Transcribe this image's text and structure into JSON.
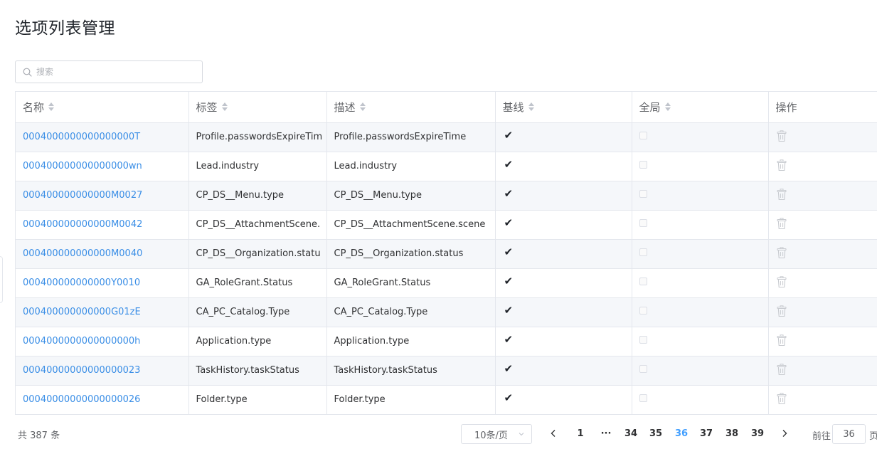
{
  "page": {
    "title": "选项列表管理"
  },
  "search": {
    "placeholder": "搜索",
    "value": ""
  },
  "table": {
    "columns": [
      "名称",
      "标签",
      "描述",
      "基线",
      "全局",
      "操作"
    ],
    "rows": [
      {
        "name": "0004000000000000000T",
        "label": "Profile.passwordsExpireTim",
        "desc": "Profile.passwordsExpireTime",
        "baseline": "✔"
      },
      {
        "name": "000400000000000000wn",
        "label": "Lead.industry",
        "desc": "Lead.industry",
        "baseline": "✔"
      },
      {
        "name": "000400000000000M0027",
        "label": "CP_DS__Menu.type",
        "desc": "CP_DS__Menu.type",
        "baseline": "✔"
      },
      {
        "name": "000400000000000M0042",
        "label": "CP_DS__AttachmentScene.",
        "desc": "CP_DS__AttachmentScene.scene",
        "baseline": "✔"
      },
      {
        "name": "000400000000000M0040",
        "label": "CP_DS__Organization.statu",
        "desc": "CP_DS__Organization.status",
        "baseline": "✔"
      },
      {
        "name": "000400000000000Y0010",
        "label": "GA_RoleGrant.Status",
        "desc": "GA_RoleGrant.Status",
        "baseline": "✔"
      },
      {
        "name": "000400000000000G01zE",
        "label": "CA_PC_Catalog.Type",
        "desc": "CA_PC_Catalog.Type",
        "baseline": "✔"
      },
      {
        "name": "0004000000000000000h",
        "label": "Application.type",
        "desc": "Application.type",
        "baseline": "✔"
      },
      {
        "name": "00040000000000000023",
        "label": "TaskHistory.taskStatus",
        "desc": "TaskHistory.taskStatus",
        "baseline": "✔"
      },
      {
        "name": "00040000000000000026",
        "label": "Folder.type",
        "desc": "Folder.type",
        "baseline": "✔"
      }
    ]
  },
  "pagination": {
    "total": "共 387 条",
    "page_size": "10条/页",
    "pages": [
      "1",
      "···",
      "34",
      "35",
      "36",
      "37",
      "38",
      "39"
    ],
    "current": "36",
    "goto_prefix": "前往",
    "goto_value": "36",
    "goto_suffix": "页"
  },
  "icons": {
    "search": "search-icon",
    "sort": "sort-caret-icon",
    "trash": "trash-icon",
    "prev": "chevron-left-icon",
    "next": "chevron-right-icon",
    "dropdown": "chevron-down-icon"
  },
  "colors": {
    "link": "#3a8ee6",
    "active_page": "#409eff",
    "stripe": "#f5f7fa",
    "border": "#e4e7ed"
  }
}
